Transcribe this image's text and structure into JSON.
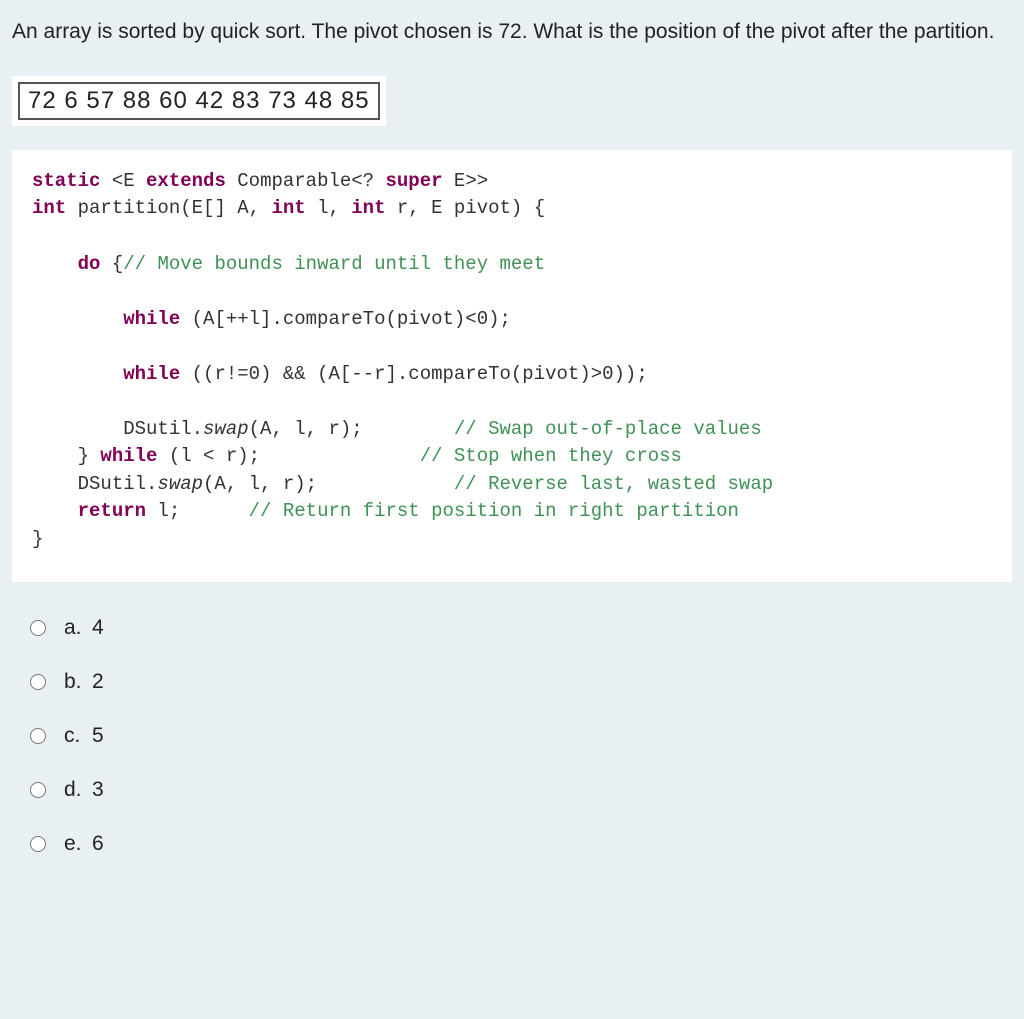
{
  "question": "An array is sorted by quick sort. The pivot chosen is 72. What is the position of the pivot after the partition.",
  "array": "72  6   57  88  60  42  83  73  48  85",
  "code": {
    "l1a": "static",
    "l1b": " <E ",
    "l1c": "extends",
    "l1d": " Comparable<? ",
    "l1e": "super",
    "l1f": " E>>",
    "l2a": "int",
    "l2b": " partition(E[] A, ",
    "l2c": "int",
    "l2d": " l, ",
    "l2e": "int",
    "l2f": " r, E pivot) {",
    "l3a": "    do",
    "l3b": " {",
    "l3c": "// Move bounds inward until they meet",
    "l4a": "        while",
    "l4b": " (A[++l].compareTo(pivot)<",
    "l4c": "0",
    "l4d": ");",
    "l5a": "        while",
    "l5b": " ((r!=",
    "l5c": "0",
    "l5d": ") && (A[--r].compareTo(pivot)>",
    "l5e": "0",
    "l5f": "));",
    "l6a": "        DSutil.",
    "l6b": "swap",
    "l6c": "(A, l, r);        ",
    "l6d": "// Swap out-of-place values",
    "l7a": "    } ",
    "l7b": "while",
    "l7c": " (l < r);              ",
    "l7d": "// Stop when they cross",
    "l8a": "    DSutil.",
    "l8b": "swap",
    "l8c": "(A, l, r);            ",
    "l8d": "// Reverse last, wasted swap",
    "l9a": "    return",
    "l9b": " l;      ",
    "l9c": "// Return first position in right partition",
    "l10": "}"
  },
  "options": [
    {
      "letter": "a.",
      "value": "4"
    },
    {
      "letter": "b.",
      "value": "2"
    },
    {
      "letter": "c.",
      "value": "5"
    },
    {
      "letter": "d.",
      "value": "3"
    },
    {
      "letter": "e.",
      "value": "6"
    }
  ]
}
